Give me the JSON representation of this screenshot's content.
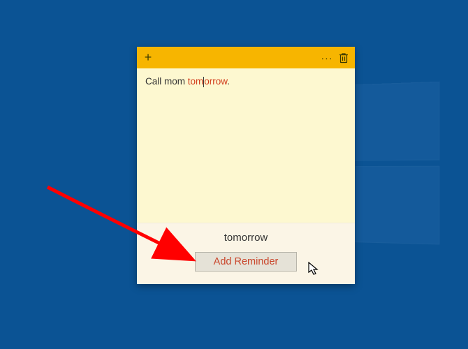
{
  "note": {
    "text_prefix": "Call mom ",
    "highlight_before_caret": "tom",
    "highlight_after_caret": "orrow",
    "text_suffix": "."
  },
  "suggestion": {
    "label": "tomorrow",
    "button_label": "Add Reminder"
  },
  "icons": {
    "add": "+",
    "more": "···"
  }
}
